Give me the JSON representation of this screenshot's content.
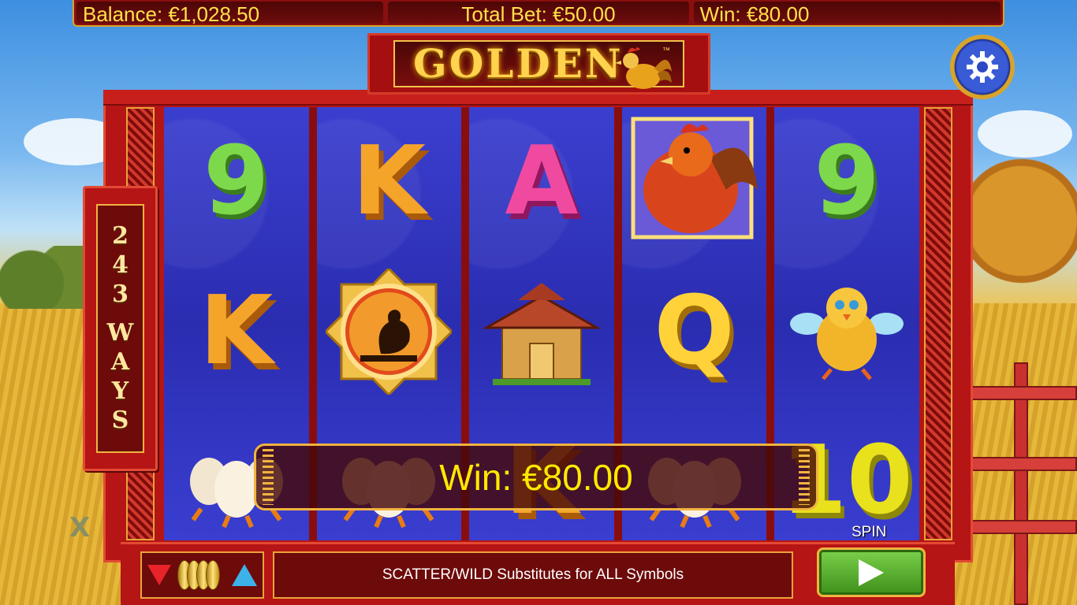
{
  "status_bar": {
    "balance": "Balance: €1,028.50",
    "total_bet": "Total Bet: €50.00",
    "win": "Win: €80.00"
  },
  "logo": {
    "text": "GOLDEN",
    "trademark": "™"
  },
  "ways_banner": {
    "line1": "243",
    "line2": "WAYS"
  },
  "reels": [
    {
      "symbols": [
        "9",
        "K",
        "eggs"
      ]
    },
    {
      "symbols": [
        "K",
        "rooster-medallion",
        "eggs"
      ]
    },
    {
      "symbols": [
        "A",
        "pagoda",
        "K"
      ]
    },
    {
      "symbols": [
        "rooster-wild",
        "Q",
        "eggs"
      ]
    },
    {
      "symbols": [
        "9",
        "chick",
        "10"
      ]
    }
  ],
  "win_panel": {
    "text": "Win: €80.00"
  },
  "message_bar": {
    "text": "SCATTER/WILD Substitutes for ALL Symbols"
  },
  "spin": {
    "label": "SPIN"
  },
  "corner_logo": {
    "text": "X"
  },
  "colors": {
    "frame_red": "#b51514",
    "reel_blue": "#2a2db0",
    "gold": "#f0b440",
    "win_text_yellow": "#ffe900",
    "bet_down_red": "#e8232a",
    "bet_up_blue": "#3cb2e8",
    "spin_green": "#5bb32e"
  },
  "icons": {
    "settings": "gear-icon",
    "bet_down": "triangle-down-icon",
    "bet_up": "triangle-up-icon",
    "coins": "coin-stack-icon",
    "spin": "play-arrow-icon"
  }
}
